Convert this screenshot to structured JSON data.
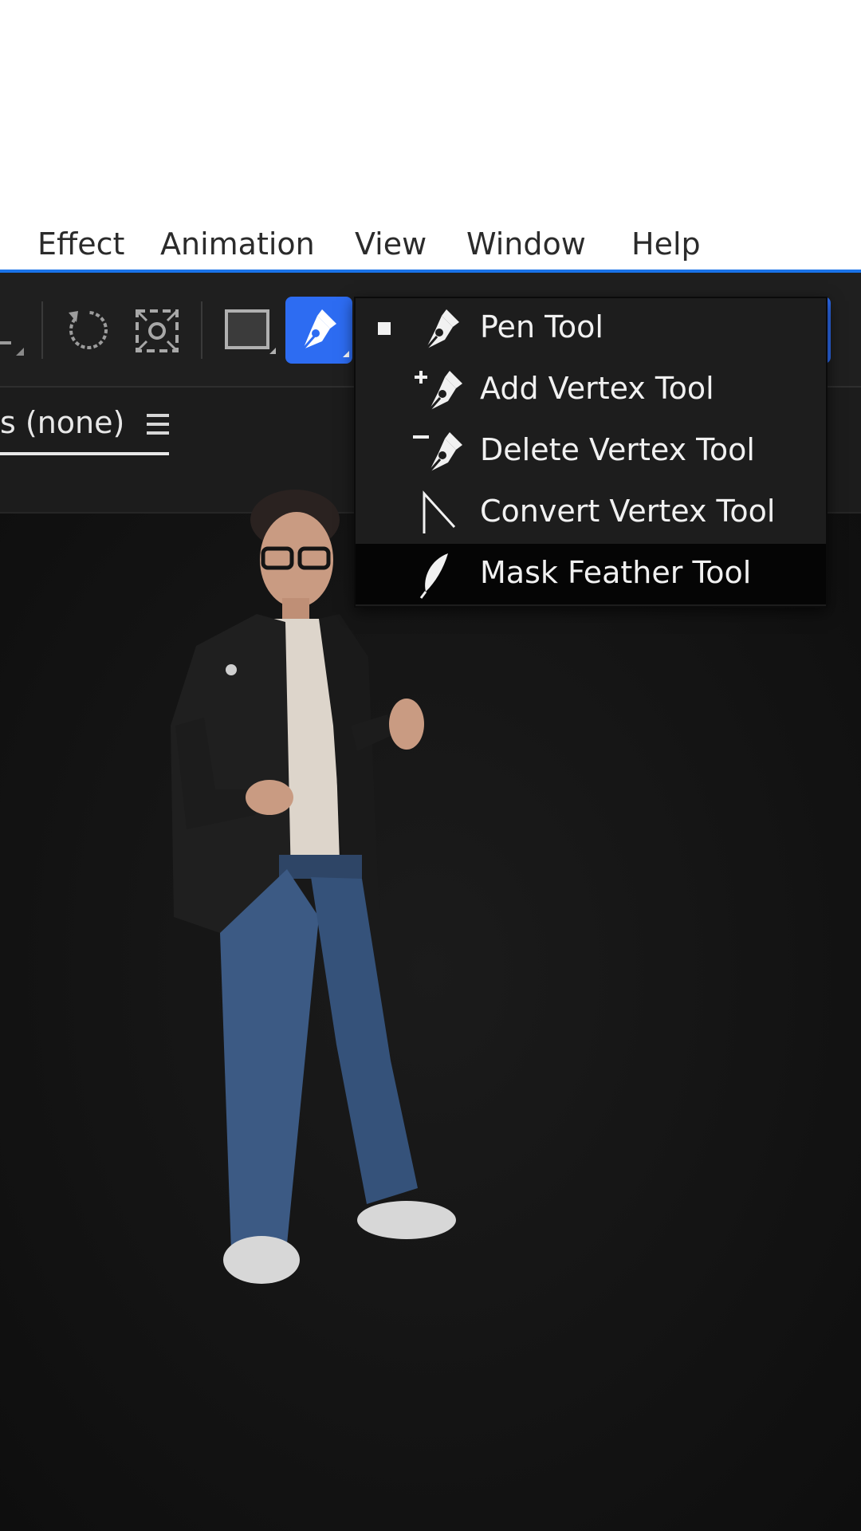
{
  "menubar": {
    "items": [
      {
        "label": "Effect"
      },
      {
        "label": "Animation"
      },
      {
        "label": "View"
      },
      {
        "label": "Window"
      },
      {
        "label": "Help"
      }
    ]
  },
  "toolbar": {
    "tools": [
      {
        "icon": "rotate-icon"
      },
      {
        "icon": "anchor-point-icon"
      },
      {
        "icon": "rectangle-tool-icon"
      },
      {
        "icon": "pen-tool-icon",
        "active": true
      }
    ],
    "accent_color": "#2d6cf2"
  },
  "panel": {
    "tab_label": "s (none)",
    "menu_icon": "hamburger-menu-icon"
  },
  "pen_menu": {
    "selected_index": 0,
    "highlighted_index": 4,
    "items": [
      {
        "label": "Pen Tool",
        "icon": "pen-icon"
      },
      {
        "label": "Add Vertex Tool",
        "icon": "add-vertex-icon"
      },
      {
        "label": "Delete Vertex Tool",
        "icon": "delete-vertex-icon"
      },
      {
        "label": "Convert Vertex Tool",
        "icon": "convert-vertex-icon"
      },
      {
        "label": "Mask Feather Tool",
        "icon": "feather-icon"
      }
    ]
  }
}
